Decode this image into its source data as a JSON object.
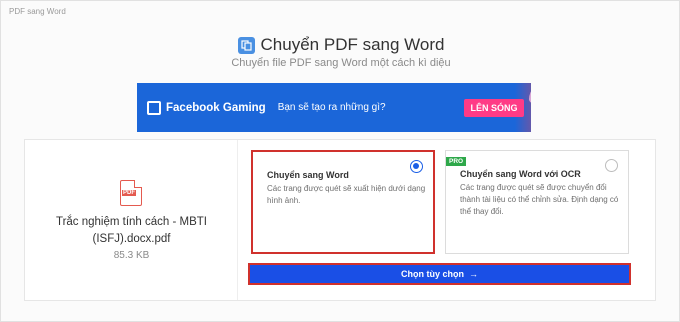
{
  "tab": {
    "label": "PDF sang Word"
  },
  "header": {
    "title": "Chuyển PDF sang Word",
    "subtitle": "Chuyển file PDF sang Word một cách kì diệu"
  },
  "ad": {
    "brand": "Facebook Gaming",
    "text": "Bạn sẽ tạo ra những gì?",
    "cta": "LÊN SÓNG"
  },
  "file": {
    "icon_label": "PDF",
    "name": "Trắc nghiệm tính cách - MBTI (ISFJ).docx.pdf",
    "size": "85.3 KB"
  },
  "options": [
    {
      "title": "Chuyển sang Word",
      "description": "Các trang được quét sẽ xuất hiện dưới dạng hình ảnh.",
      "selected": true
    },
    {
      "badge": "PRO",
      "title": "Chuyển sang Word với OCR",
      "description": "Các trang được quét sẽ được chuyển đổi thành tài liệu có thể chỉnh sửa. Định dạng có thể thay đổi.",
      "selected": false
    }
  ],
  "action": {
    "label": "Chọn tùy chọn",
    "arrow": "→"
  },
  "colors": {
    "primary": "#1a4fe6",
    "highlight": "#d0312d",
    "pro": "#2ea84a",
    "ad_bg": "#1b66d9"
  }
}
